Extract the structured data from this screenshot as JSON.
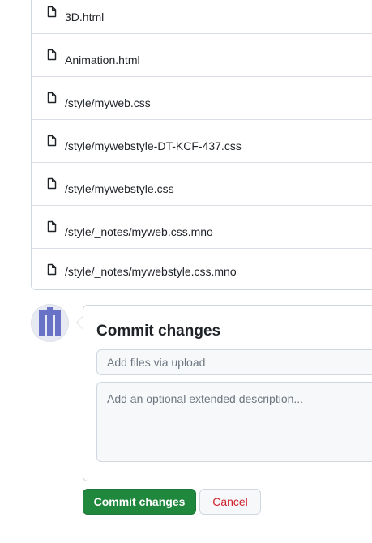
{
  "files": [
    {
      "name": "3D.html",
      "icon": "file-icon"
    },
    {
      "name": "Animation.html",
      "icon": "file-icon"
    },
    {
      "name": "/style/myweb.css",
      "icon": "file-icon"
    },
    {
      "name": "/style/mywebstyle-DT-KCF-437.css",
      "icon": "file-icon"
    },
    {
      "name": "/style/mywebstyle.css",
      "icon": "file-icon"
    },
    {
      "name": "/style/_notes/myweb.css.mno",
      "icon": "file-icon"
    },
    {
      "name": "/style/_notes/mywebstyle.css.mno",
      "icon": "file-icon"
    }
  ],
  "commit": {
    "title": "Commit changes",
    "summary_placeholder": "Add files via upload",
    "summary_value": "",
    "description_placeholder": "Add an optional extended description...",
    "description_value": ""
  },
  "buttons": {
    "commit_label": "Commit changes",
    "cancel_label": "Cancel"
  },
  "colors": {
    "commit_button": "#1f883d",
    "cancel_text": "#cf222e",
    "avatar_accent": "#6873c8"
  }
}
